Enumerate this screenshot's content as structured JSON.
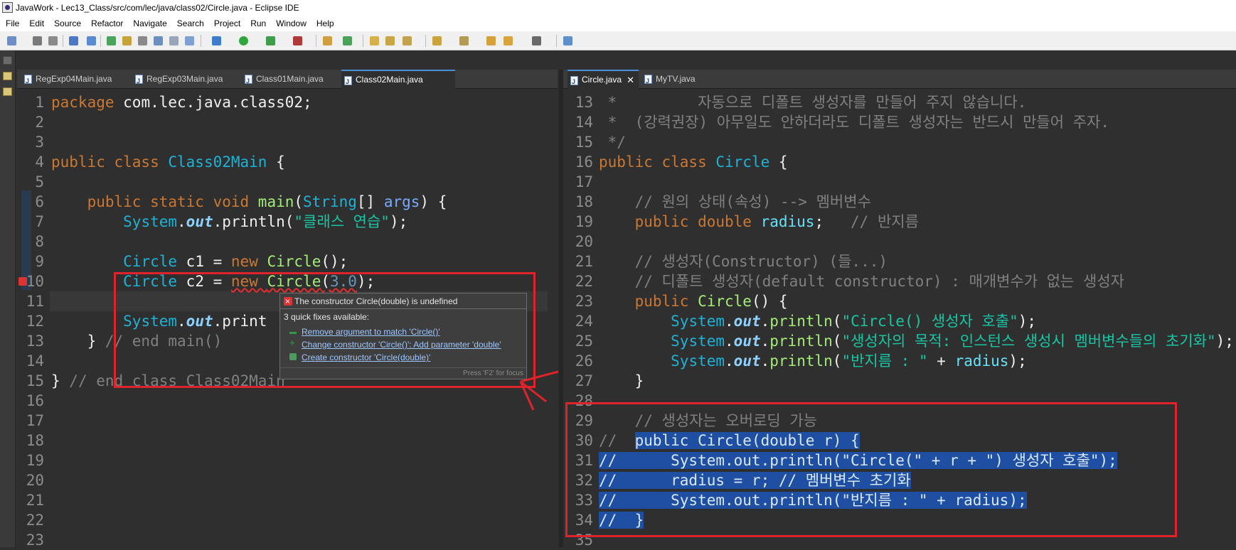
{
  "window": {
    "title": "JavaWork - Lec13_Class/src/com/lec/java/class02/Circle.java - Eclipse IDE"
  },
  "menu": [
    "File",
    "Edit",
    "Source",
    "Refactor",
    "Navigate",
    "Search",
    "Project",
    "Run",
    "Window",
    "Help"
  ],
  "left_editor": {
    "tabs": [
      {
        "label": "RegExp04Main.java",
        "active": false
      },
      {
        "label": "RegExp03Main.java",
        "active": false
      },
      {
        "label": "Class01Main.java",
        "active": false
      },
      {
        "label": "Class02Main.java",
        "active": true
      }
    ],
    "line_numbers": [
      "1",
      "2",
      "3",
      "4",
      "5",
      "6",
      "7",
      "8",
      "9",
      "10",
      "11",
      "12",
      "13",
      "14",
      "15",
      "16",
      "17",
      "18",
      "19",
      "20",
      "21",
      "22",
      "23"
    ],
    "lines": [
      [
        [
          "kw",
          "package"
        ],
        [
          "var",
          " com.lec.java.class02;"
        ]
      ],
      [],
      [],
      [
        [
          "kw",
          "public class "
        ],
        [
          "cls",
          "Class02Main"
        ],
        [
          "var",
          " {"
        ]
      ],
      [],
      [
        [
          "var",
          "    "
        ],
        [
          "kw",
          "public static void "
        ],
        [
          "meth",
          "main"
        ],
        [
          "var",
          "("
        ],
        [
          "cls",
          "String"
        ],
        [
          "var",
          "[] "
        ],
        [
          "param",
          "args"
        ],
        [
          "var",
          ") {"
        ]
      ],
      [
        [
          "var",
          "        "
        ],
        [
          "cls",
          "System"
        ],
        [
          "var",
          "."
        ],
        [
          "fldi",
          "out"
        ],
        [
          "var",
          ".println("
        ],
        [
          "str",
          "\"클래스 연습\""
        ],
        [
          "var",
          ");"
        ]
      ],
      [],
      [
        [
          "var",
          "        "
        ],
        [
          "cls",
          "Circle"
        ],
        [
          "var",
          " "
        ],
        [
          "var",
          "c1"
        ],
        [
          "var",
          " = "
        ],
        [
          "kw",
          "new "
        ],
        [
          "meth",
          "Circle"
        ],
        [
          "var",
          "();"
        ]
      ],
      [
        [
          "var",
          "        "
        ],
        [
          "cls",
          "Circle"
        ],
        [
          "var",
          " "
        ],
        [
          "var",
          "c2"
        ],
        [
          "var",
          " = "
        ],
        [
          "kw",
          "new "
        ],
        [
          "meth",
          "Circle"
        ],
        [
          "var",
          "("
        ],
        [
          "num",
          "3.0"
        ],
        [
          "var",
          ");"
        ]
      ],
      [],
      [
        [
          "var",
          "        "
        ],
        [
          "cls",
          "System"
        ],
        [
          "var",
          "."
        ],
        [
          "fldi",
          "out"
        ],
        [
          "var",
          ".print"
        ]
      ],
      [
        [
          "var",
          "    } "
        ],
        [
          "cmt",
          "// end main()"
        ]
      ],
      [],
      [
        [
          "var",
          "} "
        ],
        [
          "cmt",
          "// end class Class02Main"
        ]
      ],
      [],
      [],
      [],
      [],
      [],
      [],
      [],
      []
    ]
  },
  "quick_fix": {
    "header": "The constructor Circle(double) is undefined",
    "subtitle": "3 quick fixes available:",
    "fixes": [
      "Remove argument to match 'Circle()'",
      "Change constructor 'Circle()': Add parameter 'double'",
      "Create constructor 'Circle(double)'"
    ],
    "footer": "Press 'F2' for focus"
  },
  "right_editor": {
    "tabs": [
      {
        "label": "Circle.java",
        "active": true
      },
      {
        "label": "MyTV.java",
        "active": false
      }
    ],
    "line_numbers": [
      "13",
      "14",
      "15",
      "16",
      "17",
      "18",
      "19",
      "20",
      "21",
      "22",
      "23",
      "24",
      "25",
      "26",
      "27",
      "28",
      "29",
      "30",
      "31",
      "32",
      "33",
      "34",
      "35"
    ],
    "lines": [
      [
        [
          "cmt",
          " *         자동으로 디폴트 생성자를 만들어 주지 않습니다."
        ]
      ],
      [
        [
          "cmt",
          " *  (강력권장) 아무일도 안하더라도 디폴트 생성자는 반드시 만들어 주자."
        ]
      ],
      [
        [
          "cmt",
          " */"
        ]
      ],
      [
        [
          "kw",
          "public class "
        ],
        [
          "cls",
          "Circle"
        ],
        [
          "var",
          " {"
        ]
      ],
      [],
      [
        [
          "cmt",
          "    // 원의 상태(속성) --> 멤버변수"
        ]
      ],
      [
        [
          "var",
          "    "
        ],
        [
          "kw",
          "public double "
        ],
        [
          "fld",
          "radius"
        ],
        [
          "var",
          ";   "
        ],
        [
          "cmt",
          "// 반지름"
        ]
      ],
      [],
      [
        [
          "cmt",
          "    // 생성자(Constructor) (들...)"
        ]
      ],
      [
        [
          "cmt",
          "    // 디폴트 생성자(default constructor) : 매개변수가 없는 생성자"
        ]
      ],
      [
        [
          "var",
          "    "
        ],
        [
          "kw",
          "public "
        ],
        [
          "meth",
          "Circle"
        ],
        [
          "var",
          "() {"
        ]
      ],
      [
        [
          "var",
          "        "
        ],
        [
          "cls",
          "System"
        ],
        [
          "var",
          "."
        ],
        [
          "fldi",
          "out"
        ],
        [
          "var",
          "."
        ],
        [
          "meth",
          "println"
        ],
        [
          "var",
          "("
        ],
        [
          "str",
          "\"Circle() 생성자 호출\""
        ],
        [
          "var",
          ");"
        ]
      ],
      [
        [
          "var",
          "        "
        ],
        [
          "cls",
          "System"
        ],
        [
          "var",
          "."
        ],
        [
          "fldi",
          "out"
        ],
        [
          "var",
          "."
        ],
        [
          "meth",
          "println"
        ],
        [
          "var",
          "("
        ],
        [
          "str",
          "\"생성자의 목적: 인스턴스 생성시 멤버변수들의 초기화\""
        ],
        [
          "var",
          ");"
        ]
      ],
      [
        [
          "var",
          "        "
        ],
        [
          "cls",
          "System"
        ],
        [
          "var",
          "."
        ],
        [
          "fldi",
          "out"
        ],
        [
          "var",
          "."
        ],
        [
          "meth",
          "println"
        ],
        [
          "var",
          "("
        ],
        [
          "str",
          "\"반지름 : \""
        ],
        [
          "var",
          " + "
        ],
        [
          "fld",
          "radius"
        ],
        [
          "var",
          ");"
        ]
      ],
      [
        [
          "var",
          "    }"
        ]
      ],
      [],
      [
        [
          "cmt",
          "    // 생성자는 오버로딩 가능"
        ]
      ],
      [
        [
          "cmt",
          "//  "
        ],
        [
          "sel",
          "public Circle(double r) {"
        ]
      ],
      [
        [
          "sel",
          "//      System.out.println(\"Circle(\" + r + \") 생성자 호출\");"
        ]
      ],
      [
        [
          "sel",
          "//      radius = r; // 멤버변수 초기화"
        ]
      ],
      [
        [
          "sel",
          "//      System.out.println(\"반지름 : \" + radius);"
        ]
      ],
      [
        [
          "sel",
          "//  }"
        ]
      ],
      []
    ]
  },
  "colors": {
    "annotation": "#e0232b",
    "selection": "#1e4fa3",
    "background": "#2f2f2f"
  }
}
